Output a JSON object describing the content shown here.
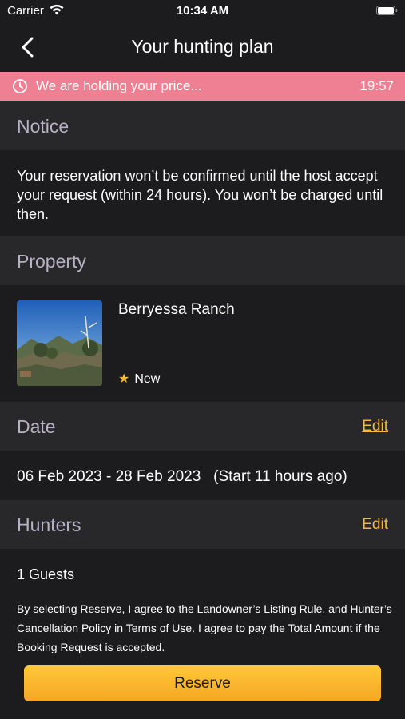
{
  "status_bar": {
    "carrier": "Carrier",
    "time": "10:34 AM"
  },
  "nav": {
    "title": "Your hunting plan",
    "back_icon": "chevron-left-icon"
  },
  "price_banner": {
    "message": "We are holding your price...",
    "timer": "19:57",
    "color": "#ef7f92"
  },
  "notice": {
    "heading": "Notice",
    "text": "Your reservation won’t be confirmed until the host accept your request (within 24 hours). You won’t be charged until then."
  },
  "property": {
    "heading": "Property",
    "name": "Berryessa Ranch",
    "rating_label": "New"
  },
  "date": {
    "heading": "Date",
    "edit_label": "Edit",
    "range": "06 Feb 2023 - 28 Feb 2023",
    "relative": "(Start 11 hours ago)"
  },
  "hunters": {
    "heading": "Hunters",
    "edit_label": "Edit",
    "guests": "1 Guests"
  },
  "footer": {
    "terms": "By selecting Reserve, I agree to the Landowner’s Listing Rule, and Hunter’s Cancellation Policy in Terms of Use. I agree to pay the Total Amount if the Booking Request is accepted.",
    "reserve_label": "Reserve"
  },
  "colors": {
    "background": "#1c1c1e",
    "section_header": "#28282a",
    "accent": "#f4b93a",
    "heading_text": "#b7b1c6"
  }
}
